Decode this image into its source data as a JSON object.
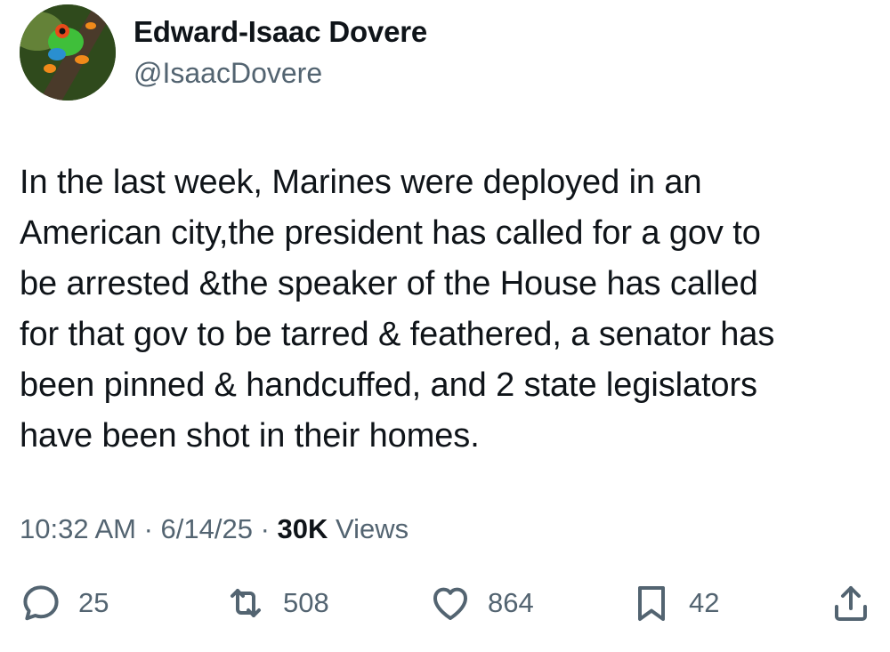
{
  "author": {
    "display_name": "Edward-Isaac Dovere",
    "handle": "@IsaacDovere"
  },
  "tweet": {
    "lines": [
      "In the last week, Marines were deployed in an",
      "American city,the president has called for a gov to",
      "be arrested &the speaker of the House has called",
      "for that gov to be tarred & feathered, a senator has",
      "been pinned & handcuffed, and 2 state legislators",
      "have been shot in their homes."
    ]
  },
  "meta": {
    "time": "10:32 AM",
    "sep1": " · ",
    "date": "6/14/25",
    "sep2": " · ",
    "views_count": "30K",
    "views_label": " Views"
  },
  "actions": {
    "reply": {
      "icon": "reply-icon",
      "count": "25"
    },
    "retweet": {
      "icon": "retweet-icon",
      "count": "508"
    },
    "like": {
      "icon": "heart-icon",
      "count": "864"
    },
    "bookmark": {
      "icon": "bookmark-icon",
      "count": "42"
    },
    "share": {
      "icon": "share-icon"
    }
  },
  "colors": {
    "text": "#0f1419",
    "secondary": "#536471",
    "background": "#ffffff"
  }
}
